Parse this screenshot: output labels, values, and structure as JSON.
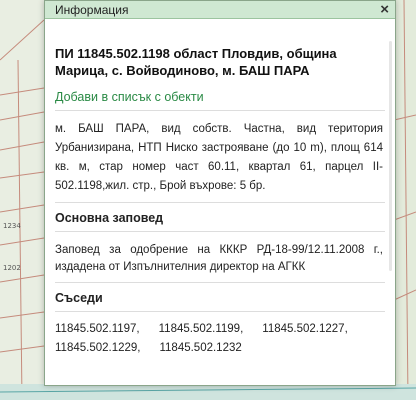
{
  "map": {
    "parcel_labels": [
      "1234",
      "1202"
    ]
  },
  "popup": {
    "title": "Информация",
    "close_glyph": "×",
    "heading": "ПИ 11845.502.1198 област Пловдив, община Марица, с. Войводиново, м. БАШ ПАРА",
    "add_link": "Добави в списък с обекти",
    "description": "м. БАШ ПАРА, вид собств. Частна, вид територия Урбанизирана, НТП Ниско застрояване (до 10 m), площ 614 кв. м, стар номер част 60.11, квартал 61, парцел II-502.1198,жил. стр., Брой въхрове: 5 бр.",
    "order_section_title": "Основна заповед",
    "order_text": "Заповед за одобрение на КККР РД-18-99/12.11.2008 г., издадена от Изпълнителния директор на АГКК",
    "neighbors_title": "Съседи",
    "neighbors": [
      "11845.502.1197,",
      "11845.502.1199,",
      "11845.502.1227,",
      "11845.502.1229,",
      "11845.502.1232"
    ]
  }
}
